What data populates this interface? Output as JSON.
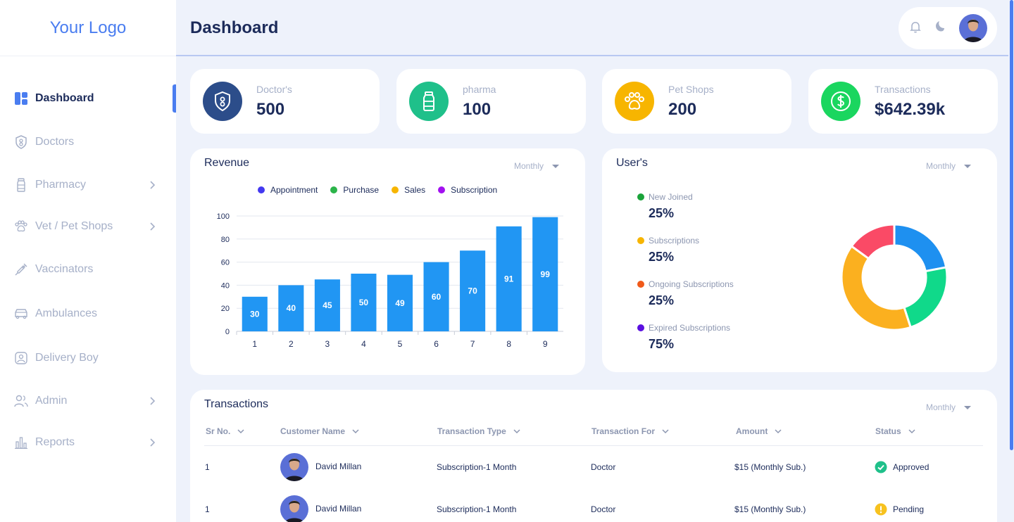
{
  "sidebar": {
    "logo": "Your Logo",
    "items": [
      {
        "label": "Dashboard"
      },
      {
        "label": "Doctors"
      },
      {
        "label": "Pharmacy"
      },
      {
        "label": "Vet / Pet Shops"
      },
      {
        "label": "Vaccinators"
      },
      {
        "label": "Ambulances"
      },
      {
        "label": "Delivery Boy"
      },
      {
        "label": "Admin"
      },
      {
        "label": "Reports"
      }
    ]
  },
  "header": {
    "title": "Dashboard"
  },
  "stats": [
    {
      "label": "Doctor's",
      "value": "500",
      "color": "#2c4d8a"
    },
    {
      "label": "pharma",
      "value": "100",
      "color": "#1fc08a"
    },
    {
      "label": "Pet Shops",
      "value": "200",
      "color": "#f7b500"
    },
    {
      "label": "Transactions",
      "value": "$642.39k",
      "color": "#1ad65f"
    }
  ],
  "revenue": {
    "title": "Revenue",
    "period": "Monthly",
    "legend": [
      {
        "name": "Appointment",
        "color": "#4338f0"
      },
      {
        "name": "Purchase",
        "color": "#2bb44a"
      },
      {
        "name": "Sales",
        "color": "#f7b500"
      },
      {
        "name": "Subscription",
        "color": "#a210f0"
      }
    ]
  },
  "chart_data": {
    "type": "bar",
    "categories": [
      "1",
      "2",
      "3",
      "4",
      "5",
      "6",
      "7",
      "8",
      "9"
    ],
    "values": [
      30,
      40,
      45,
      50,
      49,
      60,
      70,
      91,
      99
    ],
    "ylim": [
      0,
      100
    ],
    "yticks": [
      0,
      20,
      40,
      60,
      80,
      100
    ],
    "bar_color": "#2196f3",
    "grid": true
  },
  "users": {
    "title": "User's",
    "period": "Monthly",
    "items": [
      {
        "label": "New Joined",
        "value": "25%",
        "color": "#1aa33a"
      },
      {
        "label": "Subscriptions",
        "value": "25%",
        "color": "#f7b500"
      },
      {
        "label": "Ongoing Subscriptions",
        "value": "25%",
        "color": "#f05a1a"
      },
      {
        "label": "Expired Subscriptions",
        "value": "75%",
        "color": "#5a10e0"
      }
    ],
    "donut": [
      {
        "value": 22,
        "color": "#1e90f0"
      },
      {
        "value": 23,
        "color": "#10d98a"
      },
      {
        "value": 40,
        "color": "#fbb01f"
      },
      {
        "value": 15,
        "color": "#fa4a66"
      }
    ]
  },
  "transactions": {
    "title": "Transactions",
    "period": "Monthly",
    "columns": [
      "Sr No.",
      "Customer Name",
      "Transaction Type",
      "Transaction For",
      "Amount",
      "Status"
    ],
    "rows": [
      {
        "sr": "1",
        "name": "David Millan",
        "type": "Subscription-1 Month",
        "for": "Doctor",
        "amount": "$15 (Monthly Sub.)",
        "status": "Approved",
        "status_color": "#1fc08a"
      },
      {
        "sr": "1",
        "name": "David Millan",
        "type": "Subscription-1 Month",
        "for": "Doctor",
        "amount": "$15 (Monthly Sub.)",
        "status": "Pending",
        "status_color": "#f7c21f"
      }
    ]
  }
}
